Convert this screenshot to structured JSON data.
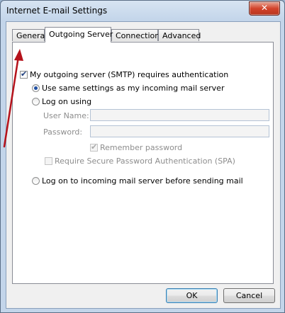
{
  "window": {
    "title": "Internet E-mail Settings",
    "close_glyph": "✕"
  },
  "tabs": [
    {
      "label": "General",
      "active": false
    },
    {
      "label": "Outgoing Server",
      "active": true
    },
    {
      "label": "Connection",
      "active": false
    },
    {
      "label": "Advanced",
      "active": false
    }
  ],
  "outgoing": {
    "smtp_auth_label": "My outgoing server (SMTP) requires authentication",
    "smtp_auth_checked": true,
    "use_same_label": "Use same settings as my incoming mail server",
    "log_on_using_label": "Log on using",
    "user_name_label": "User Name:",
    "user_name_value": "",
    "password_label": "Password:",
    "password_value": "",
    "remember_password_label": "Remember password",
    "remember_password_checked": true,
    "spa_label": "Require Secure Password Authentication (SPA)",
    "spa_checked": false,
    "log_on_incoming_label": "Log on to incoming mail server before sending mail",
    "selected_option": "use_same"
  },
  "buttons": {
    "ok": "OK",
    "cancel": "Cancel"
  },
  "annotation": {
    "arrow_color": "#b5121b"
  },
  "icons": {
    "close": "close-icon",
    "arrow": "annotation-arrow"
  }
}
